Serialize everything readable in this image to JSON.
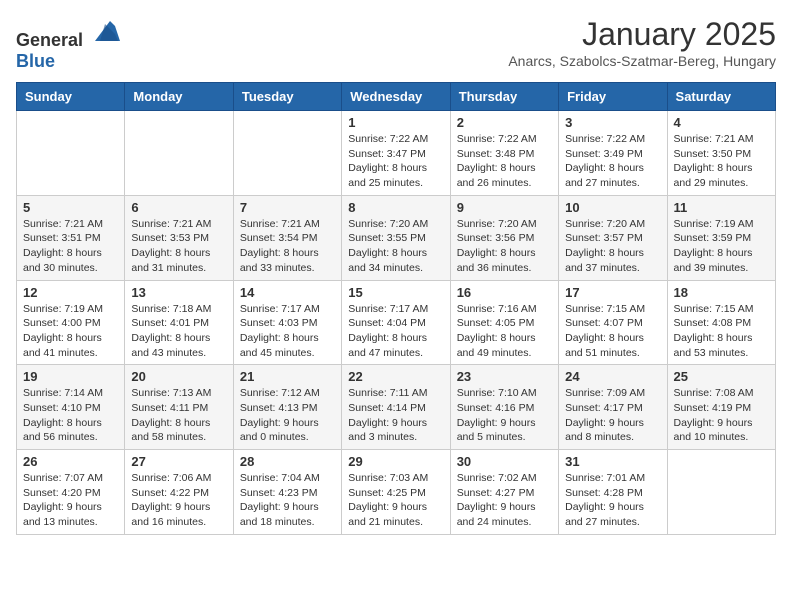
{
  "header": {
    "logo_general": "General",
    "logo_blue": "Blue",
    "month_title": "January 2025",
    "subtitle": "Anarcs, Szabolcs-Szatmar-Bereg, Hungary"
  },
  "weekdays": [
    "Sunday",
    "Monday",
    "Tuesday",
    "Wednesday",
    "Thursday",
    "Friday",
    "Saturday"
  ],
  "weeks": [
    [
      {
        "day": "",
        "info": ""
      },
      {
        "day": "",
        "info": ""
      },
      {
        "day": "",
        "info": ""
      },
      {
        "day": "1",
        "info": "Sunrise: 7:22 AM\nSunset: 3:47 PM\nDaylight: 8 hours and 25 minutes."
      },
      {
        "day": "2",
        "info": "Sunrise: 7:22 AM\nSunset: 3:48 PM\nDaylight: 8 hours and 26 minutes."
      },
      {
        "day": "3",
        "info": "Sunrise: 7:22 AM\nSunset: 3:49 PM\nDaylight: 8 hours and 27 minutes."
      },
      {
        "day": "4",
        "info": "Sunrise: 7:21 AM\nSunset: 3:50 PM\nDaylight: 8 hours and 29 minutes."
      }
    ],
    [
      {
        "day": "5",
        "info": "Sunrise: 7:21 AM\nSunset: 3:51 PM\nDaylight: 8 hours and 30 minutes."
      },
      {
        "day": "6",
        "info": "Sunrise: 7:21 AM\nSunset: 3:53 PM\nDaylight: 8 hours and 31 minutes."
      },
      {
        "day": "7",
        "info": "Sunrise: 7:21 AM\nSunset: 3:54 PM\nDaylight: 8 hours and 33 minutes."
      },
      {
        "day": "8",
        "info": "Sunrise: 7:20 AM\nSunset: 3:55 PM\nDaylight: 8 hours and 34 minutes."
      },
      {
        "day": "9",
        "info": "Sunrise: 7:20 AM\nSunset: 3:56 PM\nDaylight: 8 hours and 36 minutes."
      },
      {
        "day": "10",
        "info": "Sunrise: 7:20 AM\nSunset: 3:57 PM\nDaylight: 8 hours and 37 minutes."
      },
      {
        "day": "11",
        "info": "Sunrise: 7:19 AM\nSunset: 3:59 PM\nDaylight: 8 hours and 39 minutes."
      }
    ],
    [
      {
        "day": "12",
        "info": "Sunrise: 7:19 AM\nSunset: 4:00 PM\nDaylight: 8 hours and 41 minutes."
      },
      {
        "day": "13",
        "info": "Sunrise: 7:18 AM\nSunset: 4:01 PM\nDaylight: 8 hours and 43 minutes."
      },
      {
        "day": "14",
        "info": "Sunrise: 7:17 AM\nSunset: 4:03 PM\nDaylight: 8 hours and 45 minutes."
      },
      {
        "day": "15",
        "info": "Sunrise: 7:17 AM\nSunset: 4:04 PM\nDaylight: 8 hours and 47 minutes."
      },
      {
        "day": "16",
        "info": "Sunrise: 7:16 AM\nSunset: 4:05 PM\nDaylight: 8 hours and 49 minutes."
      },
      {
        "day": "17",
        "info": "Sunrise: 7:15 AM\nSunset: 4:07 PM\nDaylight: 8 hours and 51 minutes."
      },
      {
        "day": "18",
        "info": "Sunrise: 7:15 AM\nSunset: 4:08 PM\nDaylight: 8 hours and 53 minutes."
      }
    ],
    [
      {
        "day": "19",
        "info": "Sunrise: 7:14 AM\nSunset: 4:10 PM\nDaylight: 8 hours and 56 minutes."
      },
      {
        "day": "20",
        "info": "Sunrise: 7:13 AM\nSunset: 4:11 PM\nDaylight: 8 hours and 58 minutes."
      },
      {
        "day": "21",
        "info": "Sunrise: 7:12 AM\nSunset: 4:13 PM\nDaylight: 9 hours and 0 minutes."
      },
      {
        "day": "22",
        "info": "Sunrise: 7:11 AM\nSunset: 4:14 PM\nDaylight: 9 hours and 3 minutes."
      },
      {
        "day": "23",
        "info": "Sunrise: 7:10 AM\nSunset: 4:16 PM\nDaylight: 9 hours and 5 minutes."
      },
      {
        "day": "24",
        "info": "Sunrise: 7:09 AM\nSunset: 4:17 PM\nDaylight: 9 hours and 8 minutes."
      },
      {
        "day": "25",
        "info": "Sunrise: 7:08 AM\nSunset: 4:19 PM\nDaylight: 9 hours and 10 minutes."
      }
    ],
    [
      {
        "day": "26",
        "info": "Sunrise: 7:07 AM\nSunset: 4:20 PM\nDaylight: 9 hours and 13 minutes."
      },
      {
        "day": "27",
        "info": "Sunrise: 7:06 AM\nSunset: 4:22 PM\nDaylight: 9 hours and 16 minutes."
      },
      {
        "day": "28",
        "info": "Sunrise: 7:04 AM\nSunset: 4:23 PM\nDaylight: 9 hours and 18 minutes."
      },
      {
        "day": "29",
        "info": "Sunrise: 7:03 AM\nSunset: 4:25 PM\nDaylight: 9 hours and 21 minutes."
      },
      {
        "day": "30",
        "info": "Sunrise: 7:02 AM\nSunset: 4:27 PM\nDaylight: 9 hours and 24 minutes."
      },
      {
        "day": "31",
        "info": "Sunrise: 7:01 AM\nSunset: 4:28 PM\nDaylight: 9 hours and 27 minutes."
      },
      {
        "day": "",
        "info": ""
      }
    ]
  ]
}
